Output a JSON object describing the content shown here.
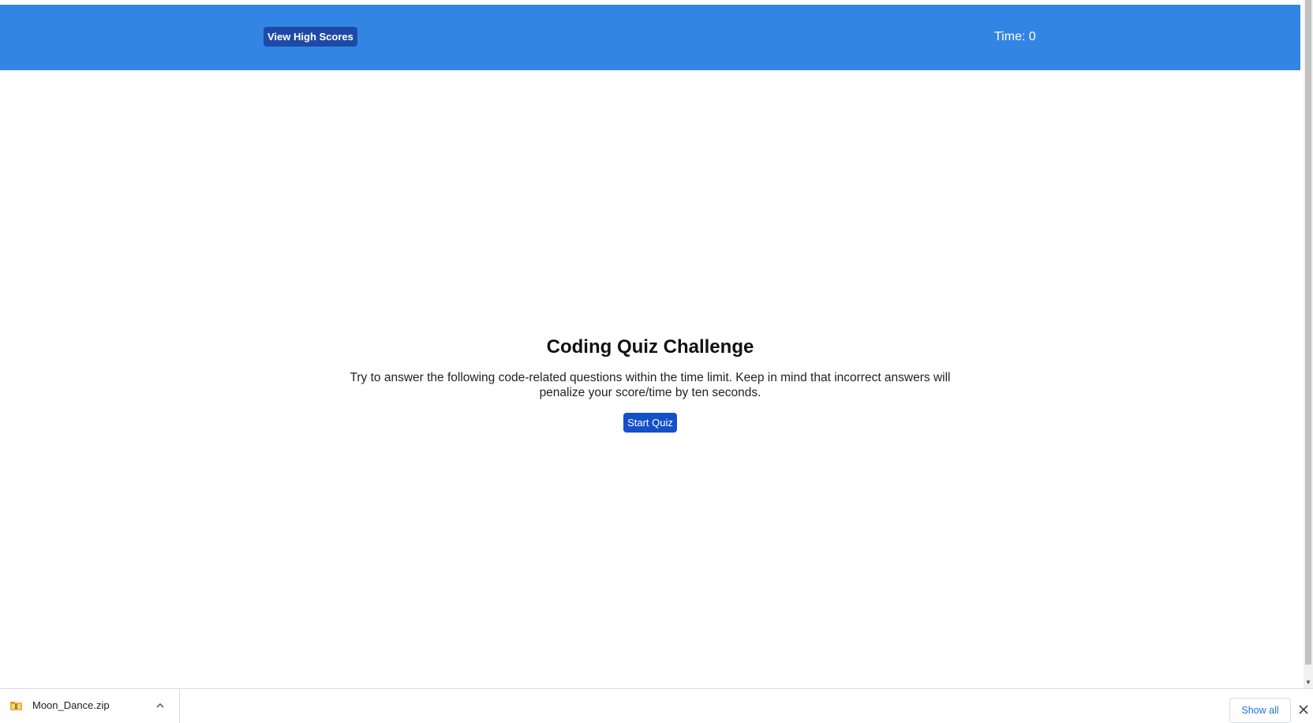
{
  "header": {
    "high_scores_label": "View High Scores",
    "timer_text": "Time: 0"
  },
  "main": {
    "title": "Coding Quiz Challenge",
    "description": "Try to answer the following code-related questions within the time limit. Keep in mind that incorrect answers will penalize your score/time by ten seconds.",
    "start_label": "Start Quiz"
  },
  "download_shelf": {
    "file_name": "Moon_Dance.zip",
    "file_icon": "zip-folder-icon",
    "show_all_label": "Show all"
  },
  "colors": {
    "header_bg": "#3385e3",
    "high_scores_button": "#1d4aa6",
    "start_button": "#1550c8",
    "show_all_text": "#1a73e8"
  }
}
